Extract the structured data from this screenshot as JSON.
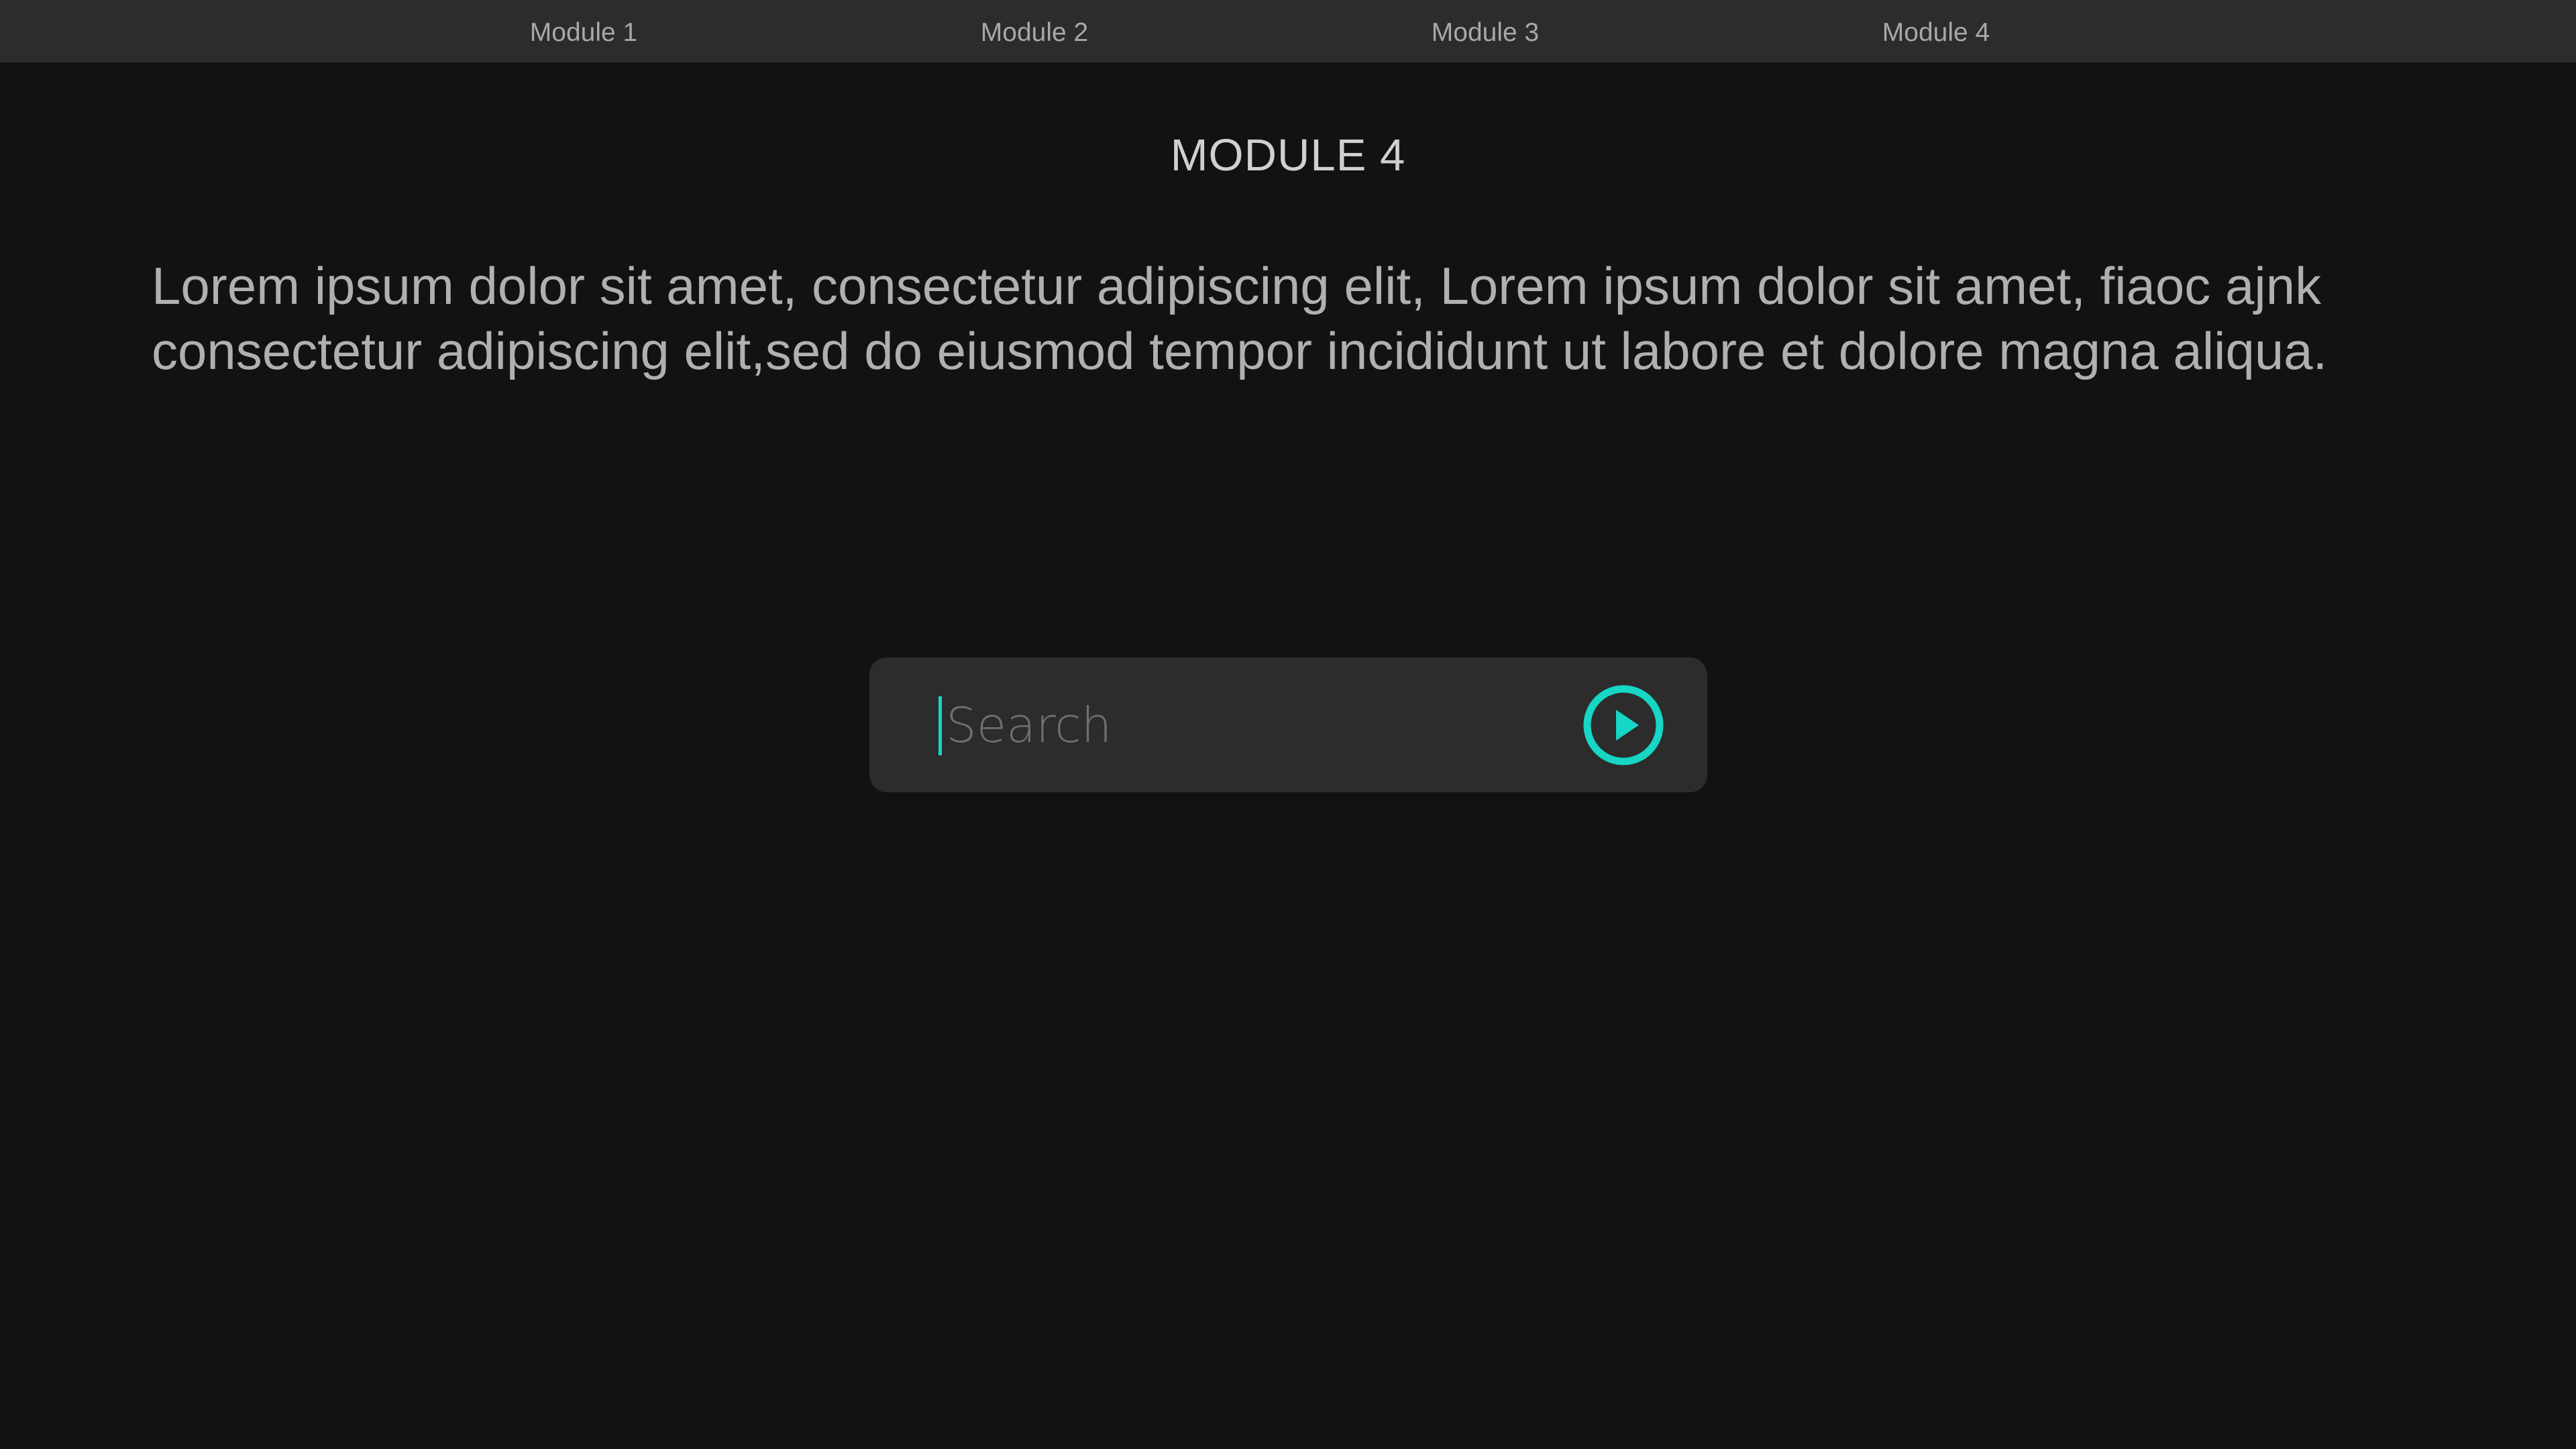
{
  "nav": {
    "items": [
      {
        "label": "Module 1"
      },
      {
        "label": "Module 2"
      },
      {
        "label": "Module 3"
      },
      {
        "label": "Module 4"
      }
    ]
  },
  "main": {
    "title": "MODULE 4",
    "description_lines": [
      "Lorem ipsum dolor sit amet, consectetur adipiscing elit, Lorem ipsum dolor sit amet, fiaoc ajnk",
      "consectetur adipiscing elit,sed do eiusmod tempor incididunt ut labore et dolore magna aliqua."
    ]
  },
  "search": {
    "placeholder": "Search",
    "value": "",
    "submit_icon": "play-circle-icon"
  },
  "colors": {
    "background": "#121212",
    "nav_background": "#2c2c2c",
    "search_background": "#2c2c2c",
    "accent": "#16d6c5"
  }
}
